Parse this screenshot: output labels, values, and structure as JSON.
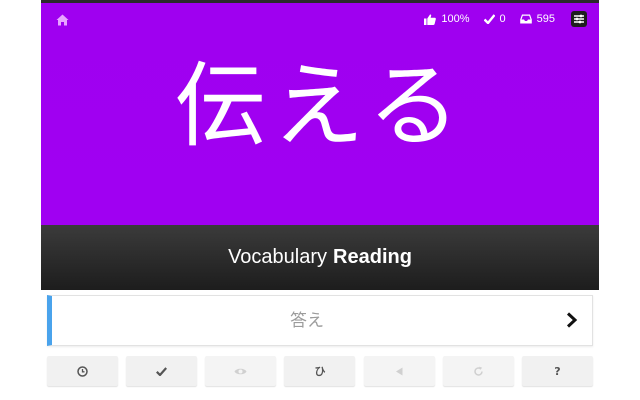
{
  "header": {
    "accuracy": "100%",
    "correct_count": "0",
    "remaining_count": "595"
  },
  "item": {
    "characters": "伝える"
  },
  "type_bar": {
    "item_type": "Vocabulary",
    "question_type": "Reading"
  },
  "answer": {
    "placeholder": "答え"
  },
  "buttons": [
    {
      "icon": "clock-icon",
      "label": ""
    },
    {
      "icon": "check-icon",
      "label": ""
    },
    {
      "icon": "eye-icon",
      "label": "",
      "disabled": true
    },
    {
      "icon": "hiragana-icon",
      "label": "ひ"
    },
    {
      "icon": "audio-icon",
      "label": "",
      "disabled": true
    },
    {
      "icon": "retry-icon",
      "label": "",
      "disabled": true
    },
    {
      "icon": "help-icon",
      "label": "?"
    }
  ],
  "colors": {
    "vocabulary_bg": "#a100f1",
    "answer_accent": "#4aa3ec"
  }
}
